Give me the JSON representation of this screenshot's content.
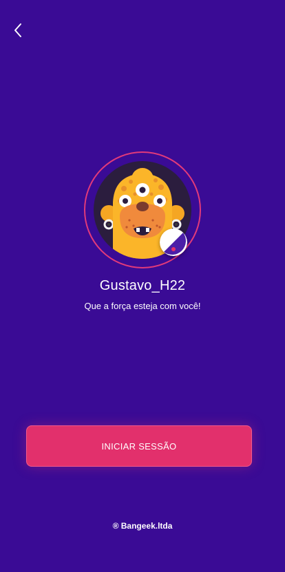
{
  "colors": {
    "background": "#3a0b95",
    "accent": "#e2306c",
    "ring": "#e23a7a"
  },
  "header": {
    "back_icon": "chevron-left-icon"
  },
  "profile": {
    "avatar_icon": "monster-avatar",
    "badge_icon": "half-moon-badge-icon",
    "username": "Gustavo_H22",
    "tagline": "Que a força esteja com você!"
  },
  "actions": {
    "start_session_label": "INICIAR SESSÃO"
  },
  "footer": {
    "brand": "® Bangeek.ltda"
  }
}
